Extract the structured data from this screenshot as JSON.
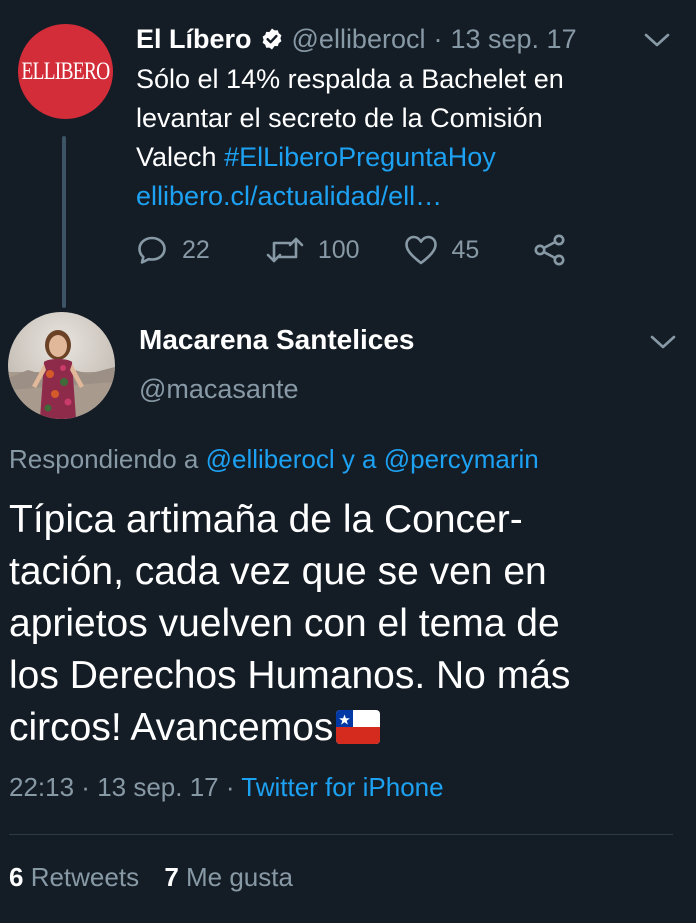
{
  "parent_tweet": {
    "avatar_text": "EL LIBERO",
    "name": "El Líbero",
    "handle": "@elliberocl",
    "separator": "·",
    "date": "13 sep. 17",
    "text_lines": [
      "Sólo el 14% respalda a Bachelet en",
      "levantar el secreto de la Comisión",
      "Valech "
    ],
    "hashtag": "#ElLiberoPreguntaHoy",
    "link": "ellibero.cl/actualidad/ell…",
    "replies": "22",
    "retweets": "100",
    "likes": "45"
  },
  "reply_tweet": {
    "name": "Macarena Santelices",
    "handle": "@macasante",
    "replying_prefix": "Respondiendo a ",
    "mention_1": "@elliberocl",
    "replying_join": " y a ",
    "mention_2": "@percymarin",
    "body_lines": [
      "Típica artimaña de la Concer-",
      "tación, cada vez que se ven en",
      "aprietos vuelven con el tema de",
      "los Derechos Humanos. No más",
      "circos! Avancemos"
    ],
    "time": "22:13",
    "separator": " · ",
    "date": "13 sep. 17",
    "source": "Twitter for iPhone",
    "retweet_count": "6",
    "retweet_label": " Retweets",
    "like_count": "7",
    "like_label": " Me gusta"
  },
  "colors": {
    "background": "#141d26",
    "secondary_text": "#8899a6",
    "link": "#1da1f2",
    "avatar_red": "#d32d3a"
  },
  "icons": [
    "verified-badge-icon",
    "chevron-down-icon",
    "reply-icon",
    "retweet-icon",
    "like-icon",
    "share-icon",
    "chile-flag-emoji"
  ]
}
